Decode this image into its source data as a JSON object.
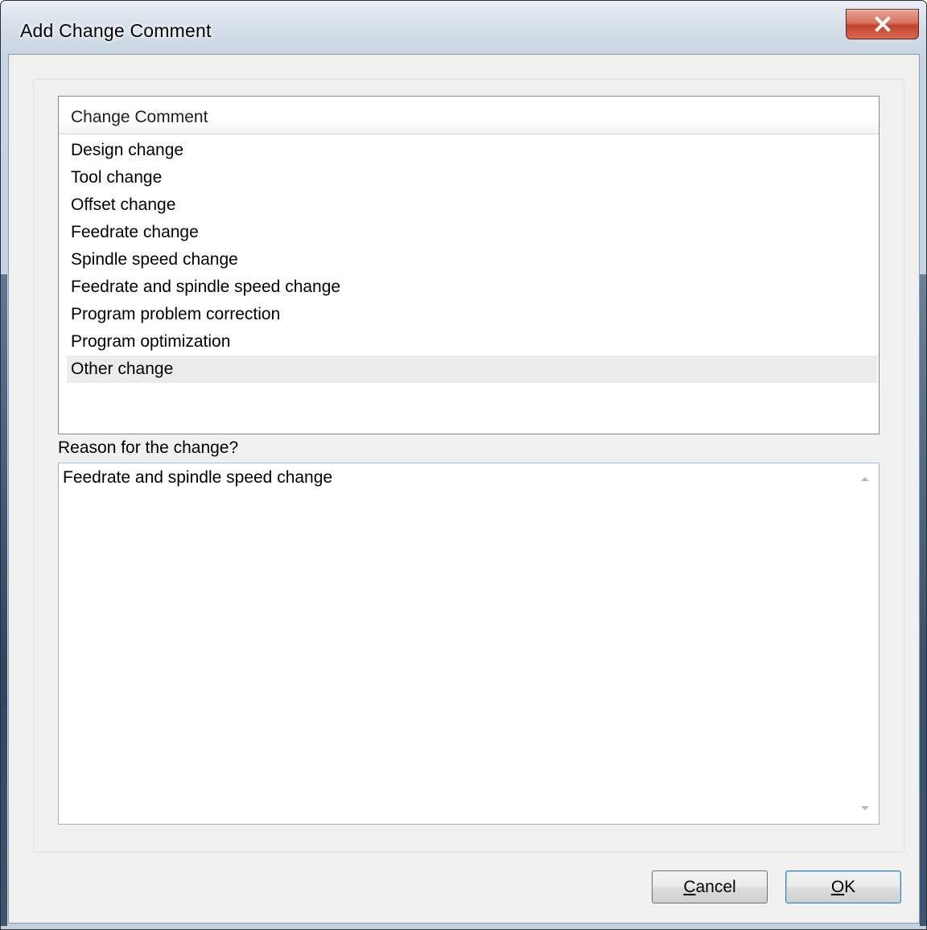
{
  "window": {
    "title": "Add Change Comment"
  },
  "list": {
    "column_header": "Change Comment",
    "items": [
      "Design change",
      "Tool change",
      "Offset change",
      "Feedrate change",
      "Spindle speed change",
      "Feedrate and spindle speed change",
      "Program problem correction",
      "Program optimization",
      "Other change"
    ],
    "highlighted_item": "Other change"
  },
  "reason": {
    "label": "Reason for the change?",
    "value": "Feedrate and spindle speed change"
  },
  "buttons": {
    "cancel_mnemonic": "C",
    "cancel_rest": "ancel",
    "ok_mnemonic": "O",
    "ok_rest": "K"
  },
  "icons": {
    "close": "close-icon",
    "scroll_up": "scroll-up-arrow-icon",
    "scroll_down": "scroll-down-arrow-icon"
  },
  "colors": {
    "close_button": "#c1432b",
    "client_bg": "#f0f0f0",
    "highlight_row": "#ececec",
    "default_button_border": "#3c7fb1"
  }
}
